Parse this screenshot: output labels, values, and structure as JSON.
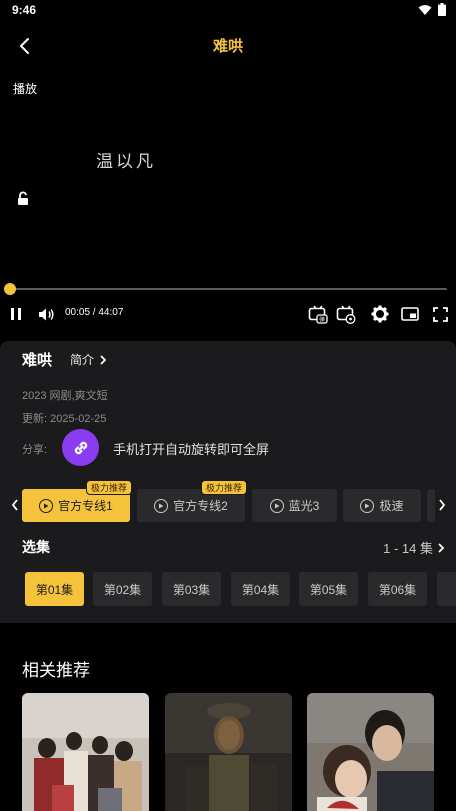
{
  "status_bar": {
    "time": "9:46"
  },
  "header": {
    "title": "难哄"
  },
  "player": {
    "play_label": "播放",
    "watermark": "温以凡",
    "current_time": "00:05",
    "duration": "44:07",
    "time_display": "00:05 / 44:07",
    "progress": 0.002
  },
  "info": {
    "title": "难哄",
    "intro_label": "简介",
    "meta": "2023 网剧,爽文短",
    "updated": "更新: 2025-02-25",
    "share_label": "分享:",
    "share_hint": "手机打开自动旋转即可全屏"
  },
  "lines": [
    {
      "label": "官方专线1",
      "badge": "极力推荐",
      "active": true
    },
    {
      "label": "官方专线2",
      "badge": "极力推荐",
      "active": false
    },
    {
      "label": "蓝光3",
      "badge": "",
      "active": false
    },
    {
      "label": "极速",
      "badge": "",
      "active": false
    }
  ],
  "episodes": {
    "title": "选集",
    "range": "1 - 14 集",
    "items": [
      "第01集",
      "第02集",
      "第03集",
      "第04集",
      "第05集",
      "第06集"
    ]
  },
  "recommend": {
    "title": "相关推荐"
  },
  "colors": {
    "accent": "#f5c33b",
    "panel": "#1b1b1d",
    "share": "#8a3cf0"
  }
}
